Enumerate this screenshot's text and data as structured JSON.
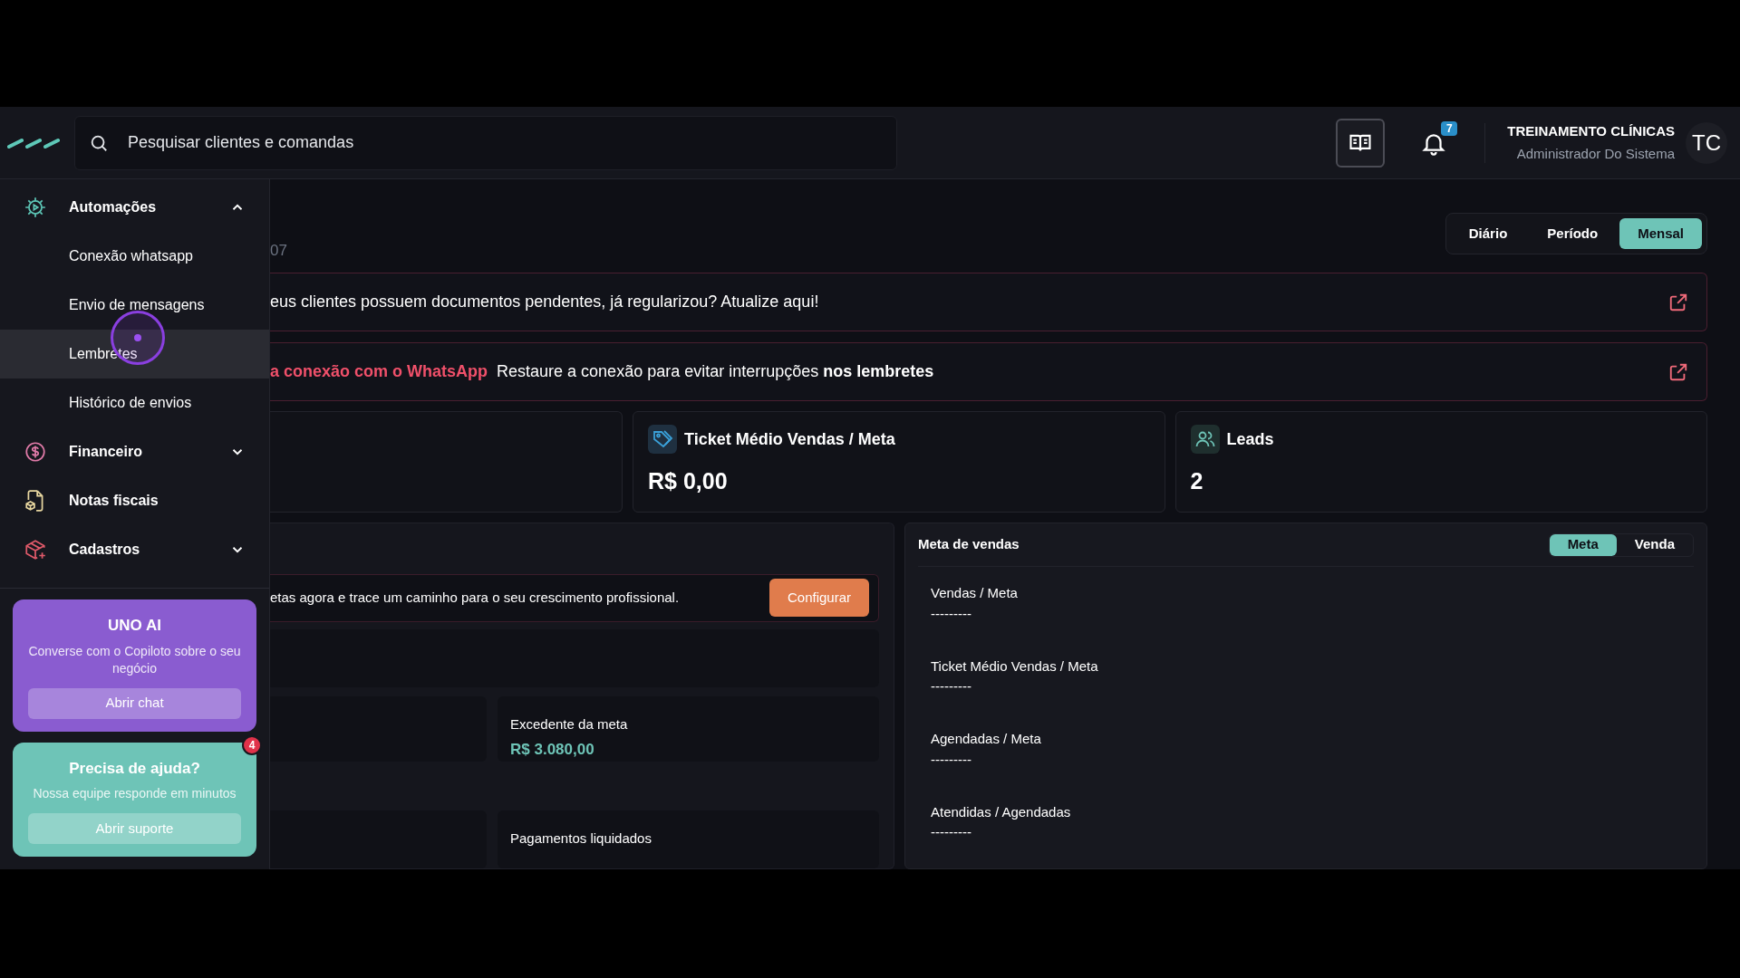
{
  "header": {
    "search": {
      "placeholder": "Pesquisar clientes e comandas"
    },
    "notifications": {
      "count": "7"
    },
    "user": {
      "name": "TREINAMENTO CLÍNICAS",
      "role": "Administrador Do Sistema",
      "initials": "TC"
    }
  },
  "sidebar": {
    "items": [
      {
        "label": "Automações",
        "expanded": true,
        "children": [
          {
            "label": "Conexão whatsapp",
            "selected": false
          },
          {
            "label": "Envio de mensagens",
            "selected": false
          },
          {
            "label": "Lembretes",
            "selected": true
          },
          {
            "label": "Histórico de envios",
            "selected": false
          }
        ]
      },
      {
        "label": "Financeiro",
        "expanded": false
      },
      {
        "label": "Notas fiscais"
      },
      {
        "label": "Cadastros",
        "expanded": false
      }
    ]
  },
  "assistant_card": {
    "title": "UNO AI",
    "text": "Converse com o Copiloto sobre o seu negócio",
    "button": "Abrir chat"
  },
  "help_card": {
    "title": "Precisa de ajuda?",
    "text": "Nossa equipe responde em minutos",
    "button": "Abrir suporte",
    "badge": "4"
  },
  "date_fragment": "07",
  "period_tabs": [
    {
      "label": "Diário",
      "selected": false
    },
    {
      "label": "Período",
      "selected": false
    },
    {
      "label": "Mensal",
      "selected": true
    }
  ],
  "alerts": [
    {
      "text": "eus clientes possuem documentos pendentes, já regularizou? Atualize aqui!"
    },
    {
      "title": "a conexão com o WhatsApp",
      "text": "Restaure a conexão para evitar interrupções **nos lembretes**"
    }
  ],
  "stat_cards": [
    {
      "title": "Ticket Médio Vendas / Meta",
      "value": "R$ 0,00"
    },
    {
      "title": "Leads",
      "value": "2"
    }
  ],
  "goals_panel": {
    "banner": {
      "text": "etas agora e trace um caminho para o seu crescimento profissional.",
      "button": "Configurar"
    },
    "boxes": [
      {
        "label": "Excedente da meta",
        "value": "R$ 3.080,00"
      },
      {
        "label": "Pagamentos liquidados"
      }
    ]
  },
  "sales_goal": {
    "title": "Meta de vendas",
    "toggle": [
      {
        "label": "Meta",
        "selected": true
      },
      {
        "label": "Venda",
        "selected": false
      }
    ],
    "metrics": [
      {
        "label": "Vendas / Meta",
        "value": "---------"
      },
      {
        "label": "Ticket Médio Vendas / Meta",
        "value": "---------"
      },
      {
        "label": "Agendadas / Meta",
        "value": "---------"
      },
      {
        "label": "Atendidas / Agendadas",
        "value": "---------"
      }
    ]
  }
}
